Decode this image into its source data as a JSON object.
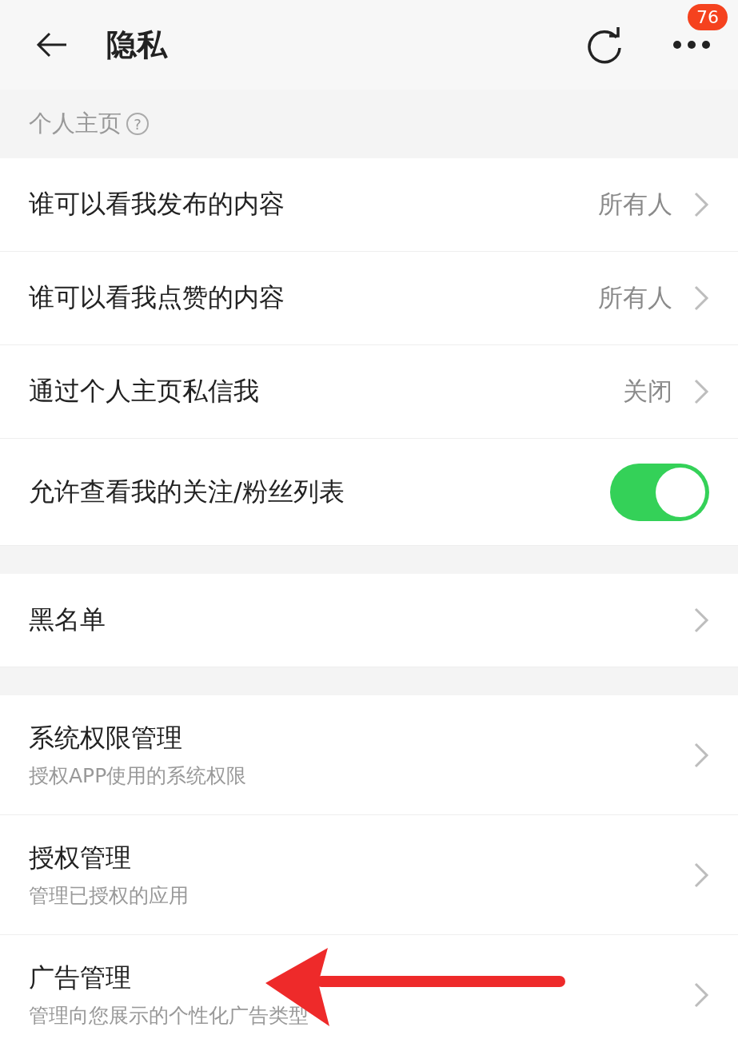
{
  "header": {
    "title": "隐私",
    "badge": "76"
  },
  "groups": [
    {
      "label": "个人主页",
      "help": "?",
      "items": [
        {
          "kind": "link",
          "title": "谁可以看我发布的内容",
          "value": "所有人"
        },
        {
          "kind": "link",
          "title": "谁可以看我点赞的内容",
          "value": "所有人"
        },
        {
          "kind": "link",
          "title": "通过个人主页私信我",
          "value": "关闭"
        },
        {
          "kind": "toggle",
          "title": "允许查看我的关注/粉丝列表",
          "on": true
        }
      ]
    },
    {
      "items": [
        {
          "kind": "link",
          "title": "黑名单"
        }
      ]
    },
    {
      "items": [
        {
          "kind": "link",
          "title": "系统权限管理",
          "subtitle": "授权APP使用的系统权限"
        },
        {
          "kind": "link",
          "title": "授权管理",
          "subtitle": "管理已授权的应用"
        },
        {
          "kind": "link",
          "title": "广告管理",
          "subtitle": "管理向您展示的个性化广告类型"
        }
      ]
    }
  ]
}
